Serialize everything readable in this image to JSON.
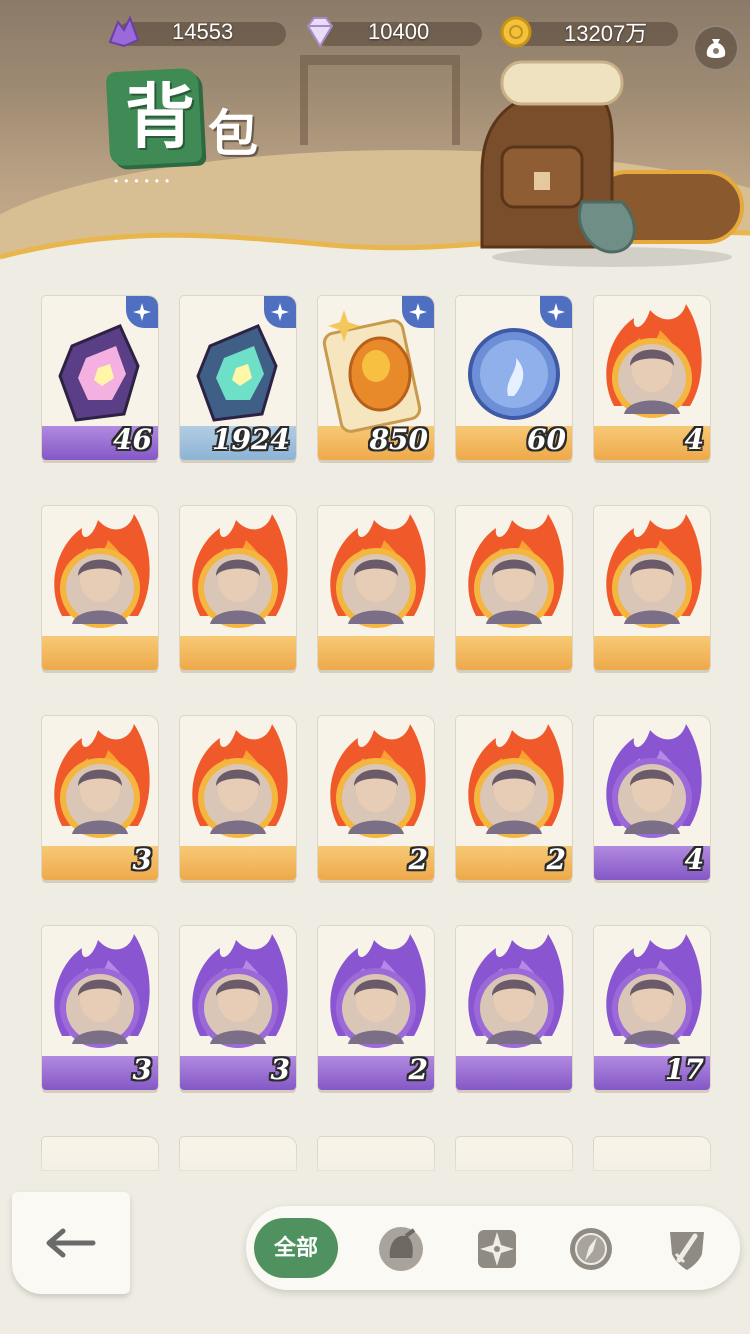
{
  "resources": {
    "crystal": {
      "icon": "purple-crystal-icon",
      "value": "14553"
    },
    "diamond": {
      "icon": "diamond-icon",
      "value": "10400"
    },
    "gold": {
      "icon": "gold-coin-icon",
      "value": "13207万"
    }
  },
  "header": {
    "title_main": "背",
    "title_sub": "包",
    "dots": "••••••"
  },
  "items": [
    {
      "rarity": "purple",
      "art": "purple-gem-icon",
      "quantity": "46",
      "starred": true
    },
    {
      "rarity": "blue",
      "art": "teal-gem-icon",
      "quantity": "1924",
      "starred": true
    },
    {
      "rarity": "gold",
      "art": "amber-medallion-icon",
      "quantity": "850",
      "starred": true
    },
    {
      "rarity": "gold",
      "art": "blue-coin-icon",
      "quantity": "60",
      "starred": true
    },
    {
      "rarity": "gold",
      "art": "hero-portrait-silver-hair",
      "quantity": "4"
    },
    {
      "rarity": "gold",
      "art": "hero-portrait-pirate",
      "quantity": ""
    },
    {
      "rarity": "gold",
      "art": "hero-portrait-green-demon",
      "quantity": ""
    },
    {
      "rarity": "gold",
      "art": "hero-portrait-white-vampire",
      "quantity": ""
    },
    {
      "rarity": "gold",
      "art": "hero-portrait-fox-boy",
      "quantity": ""
    },
    {
      "rarity": "gold",
      "art": "hero-portrait-pink-girl",
      "quantity": ""
    },
    {
      "rarity": "gold",
      "art": "hero-portrait-blonde-man",
      "quantity": "3"
    },
    {
      "rarity": "gold",
      "art": "hero-portrait-elf",
      "quantity": ""
    },
    {
      "rarity": "gold",
      "art": "hero-portrait-grey-lady",
      "quantity": "2"
    },
    {
      "rarity": "gold",
      "art": "hero-portrait-brunette",
      "quantity": "2"
    },
    {
      "rarity": "purple",
      "art": "hero-portrait-blond-rogue",
      "quantity": "4"
    },
    {
      "rarity": "purple",
      "art": "hero-portrait-tree-beast",
      "quantity": "3"
    },
    {
      "rarity": "purple",
      "art": "hero-portrait-dark-boy",
      "quantity": "3"
    },
    {
      "rarity": "purple",
      "art": "hero-portrait-captain",
      "quantity": "2"
    },
    {
      "rarity": "purple",
      "art": "hero-portrait-dark-elf",
      "quantity": ""
    },
    {
      "rarity": "purple",
      "art": "hero-portrait-goblin",
      "quantity": "17"
    }
  ],
  "filters": {
    "all_label": "全部",
    "icons": [
      "helmet-icon",
      "shuriken-icon",
      "compass-icon",
      "sword-shield-icon"
    ]
  },
  "colors": {
    "accent_green": "#4f9260",
    "purple_rarity": "#8458c6",
    "gold_rarity": "#eea94b",
    "blue_rarity": "#8cb3d4",
    "star_badge": "#4f6fc0"
  }
}
